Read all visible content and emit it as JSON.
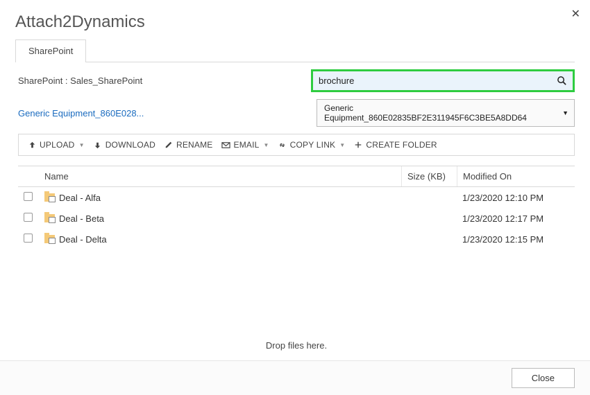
{
  "header": {
    "title": "Attach2Dynamics"
  },
  "tabs": {
    "active": "SharePoint"
  },
  "sharepoint": {
    "label": "SharePoint : Sales_SharePoint",
    "breadcrumb": "Generic Equipment_860E028...",
    "folder_selected": "Generic Equipment_860E02835BF2E311945F6C3BE5A8DD64"
  },
  "search": {
    "value": "brochure"
  },
  "toolbar": {
    "upload": "UPLOAD",
    "download": "DOWNLOAD",
    "rename": "RENAME",
    "email": "EMAIL",
    "copylink": "COPY LINK",
    "createfolder": "CREATE FOLDER"
  },
  "grid": {
    "columns": {
      "name": "Name",
      "size": "Size (KB)",
      "modified": "Modified On"
    },
    "rows": [
      {
        "name": "Deal - Alfa",
        "size": "",
        "modified": "1/23/2020 12:10 PM"
      },
      {
        "name": "Deal - Beta",
        "size": "",
        "modified": "1/23/2020 12:17 PM"
      },
      {
        "name": "Deal - Delta",
        "size": "",
        "modified": "1/23/2020 12:15 PM"
      }
    ]
  },
  "drop_hint": "Drop files here.",
  "footer": {
    "close": "Close"
  }
}
